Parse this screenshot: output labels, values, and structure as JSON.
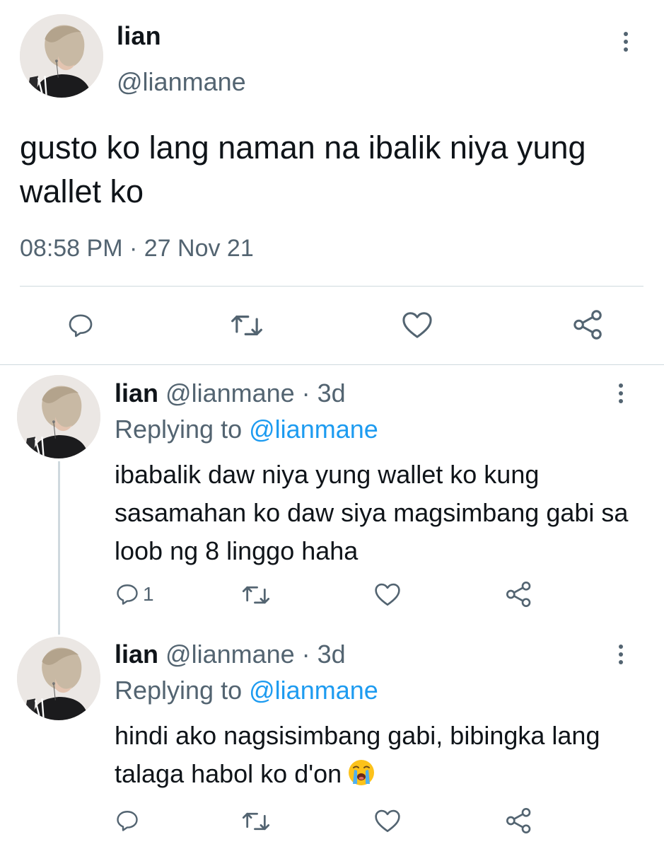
{
  "main_tweet": {
    "name": "lian",
    "handle": "@lianmane",
    "text": "gusto ko lang naman na ibalik niya yung wallet ko",
    "timestamp": "08:58 PM · 27 Nov 21"
  },
  "replies": [
    {
      "name": "lian",
      "handle_time": "@lianmane · 3d",
      "replying_prefix": "Replying to",
      "replying_handle": "@lianmane",
      "text": "ibabalik daw niya yung wallet ko kung sasamahan ko daw siya magsimbang gabi sa loob ng 8 linggo haha",
      "reply_count": "1"
    },
    {
      "name": "lian",
      "handle_time": "@lianmane · 3d",
      "replying_prefix": "Replying to",
      "replying_handle": "@lianmane",
      "text": "hindi ako nagsisimbang gabi, bibingka lang talaga habol ko d'on",
      "emoji": "loudly-crying-face",
      "reply_count": ""
    }
  ],
  "icons": {
    "reply": "reply-icon",
    "retweet": "retweet-icon",
    "like": "heart-icon",
    "share": "share-icon",
    "more": "more-vertical-icon"
  },
  "colors": {
    "text": "#0f1419",
    "secondary": "#536471",
    "link": "#1d9bf0",
    "divider": "#cfd9de"
  }
}
